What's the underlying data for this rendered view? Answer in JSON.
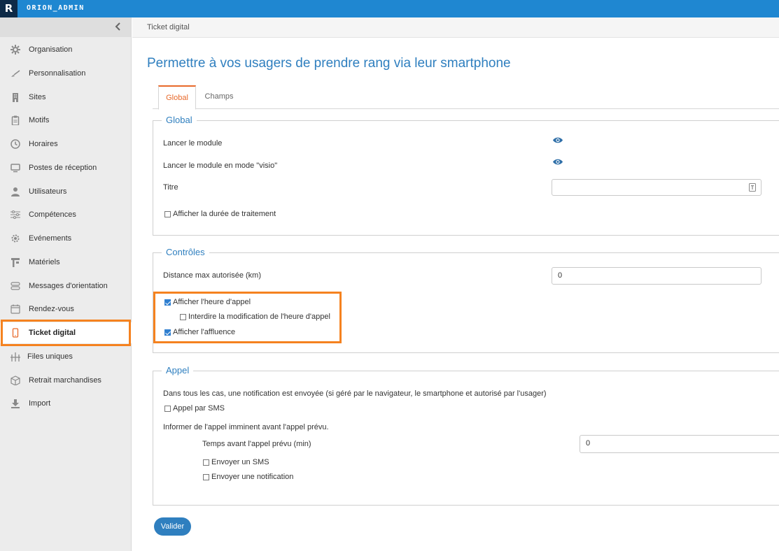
{
  "app": {
    "logo": "R",
    "name": "ORION_ADMIN"
  },
  "sidebar": {
    "items": [
      {
        "label": "Organisation",
        "icon": "gear-icon"
      },
      {
        "label": "Personnalisation",
        "icon": "brush-icon"
      },
      {
        "label": "Sites",
        "icon": "building-icon"
      },
      {
        "label": "Motifs",
        "icon": "clipboard-icon"
      },
      {
        "label": "Horaires",
        "icon": "clock-icon"
      },
      {
        "label": "Postes de réception",
        "icon": "monitor-icon"
      },
      {
        "label": "Utilisateurs",
        "icon": "user-icon"
      },
      {
        "label": "Compétences",
        "icon": "sliders-icon"
      },
      {
        "label": "Evénements",
        "icon": "cog-icon"
      },
      {
        "label": "Matériels",
        "icon": "kiosk-icon"
      },
      {
        "label": "Messages d'orientation",
        "icon": "signpost-icon"
      },
      {
        "label": "Rendez-vous",
        "icon": "calendar-icon"
      },
      {
        "label": "Ticket digital",
        "icon": "smartphone-icon",
        "active": true
      },
      {
        "label": "Files uniques",
        "icon": "queue-icon"
      },
      {
        "label": "Retrait marchandises",
        "icon": "box-icon"
      },
      {
        "label": "Import",
        "icon": "download-icon"
      }
    ]
  },
  "breadcrumb": "Ticket digital",
  "page_title": "Permettre à vos usagers de prendre rang via leur smartphone",
  "tabs": [
    {
      "label": "Global",
      "active": true
    },
    {
      "label": "Champs",
      "active": false
    }
  ],
  "global_section": {
    "legend": "Global",
    "launch_module_label": "Lancer le module",
    "launch_visio_label": "Lancer le module en mode \"visio\"",
    "title_label": "Titre",
    "title_value": "",
    "show_duration_label": "Afficher la durée de traitement",
    "show_duration_checked": false
  },
  "controles_section": {
    "legend": "Contrôles",
    "distance_label": "Distance max autorisée (km)",
    "distance_value": "0",
    "show_call_time_label": "Afficher l'heure d'appel",
    "show_call_time_checked": true,
    "forbid_change_label": "Interdire la modification de l'heure d'appel",
    "forbid_change_checked": false,
    "show_affluence_label": "Afficher l'affluence",
    "show_affluence_checked": true
  },
  "appel_section": {
    "legend": "Appel",
    "info_text": "Dans tous les cas, une notification est envoyée (si géré par le navigateur, le smartphone et autorisé par l'usager)",
    "sms_call_label": "Appel par SMS",
    "sms_call_checked": false,
    "imminent_label": "Informer de l'appel imminent avant l'appel prévu.",
    "time_before_label": "Temps avant l'appel prévu (min)",
    "time_before_value": "0",
    "send_sms_label": "Envoyer un SMS",
    "send_sms_checked": false,
    "send_notification_label": "Envoyer une notification",
    "send_notification_checked": false
  },
  "submit_label": "Valider",
  "colors": {
    "topbar": "#1f87d1",
    "accent": "#2f7fbf",
    "highlight": "#f5821f",
    "active_tab": "#e8692a"
  }
}
